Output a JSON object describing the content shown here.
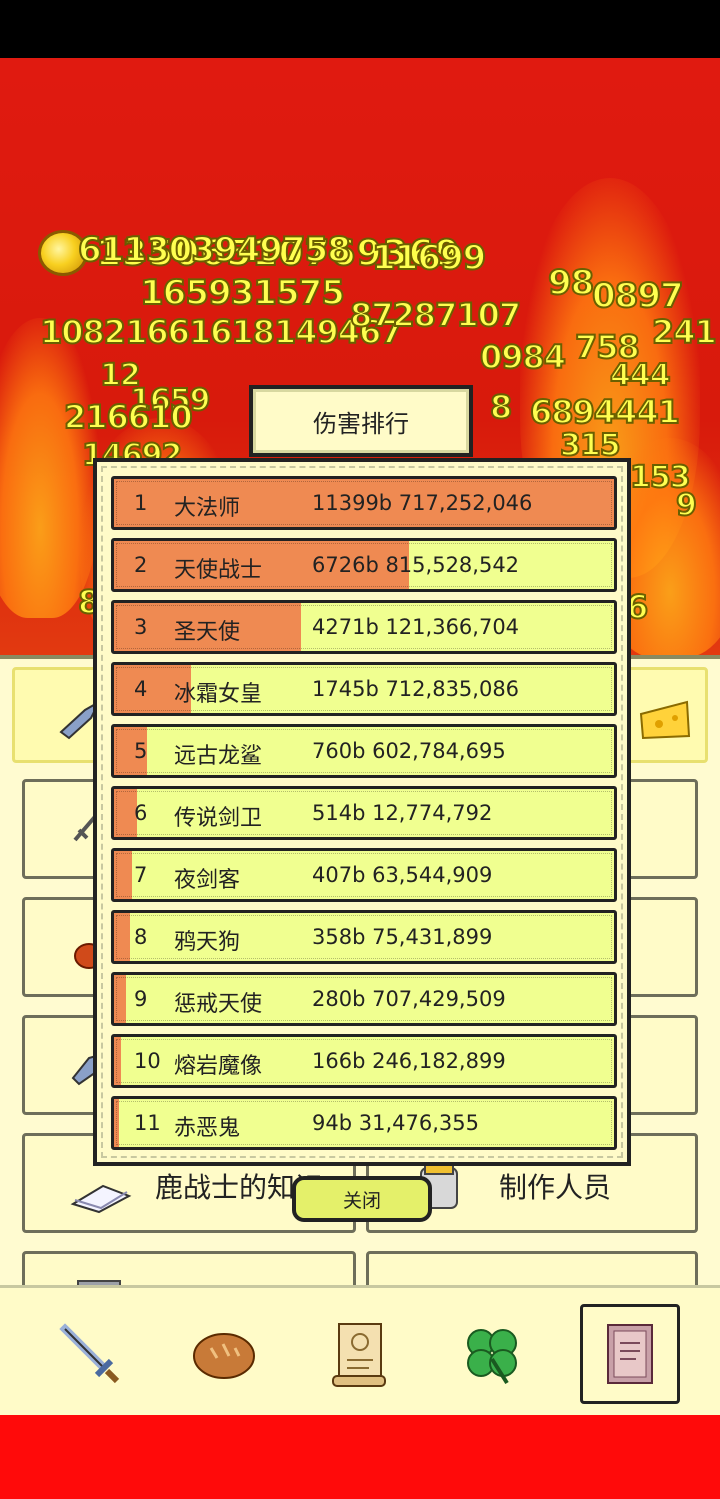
{
  "colors": {
    "background_red": "#e01a10",
    "gold_text": "#ffff4a",
    "row_fill": "#ef8a52",
    "row_bg": "#f0ff90",
    "panel_bg": "#fffbc8"
  },
  "header": {
    "coin_icon": "gold-coin",
    "coin_value": "13506510769369"
  },
  "floating_damage": [
    "611303949758",
    "11699",
    "165931575",
    "98",
    "0897",
    "10821661618149467",
    "0984",
    "758",
    "241",
    "87287107",
    "12",
    "1659",
    "444",
    "216610",
    "8",
    "6894441",
    "14692",
    "315",
    "153",
    "9",
    "8",
    "6"
  ],
  "menu": {
    "cards": [
      {
        "icon": "sword-icon",
        "label": ""
      },
      {
        "icon": "fist-icon",
        "label": ""
      },
      {
        "icon": "shoe-icon",
        "label": ""
      },
      {
        "icon": "book-icon",
        "label": "鹿战士的知识"
      },
      {
        "icon": "mug-icon",
        "label": "制作人员"
      }
    ]
  },
  "modal": {
    "title": "伤害排行",
    "close_label": "关闭",
    "max_damage": 11399,
    "rows": [
      {
        "rank": "1",
        "name": "大法师",
        "value": "11399b 717,252,046",
        "damage": 11399
      },
      {
        "rank": "2",
        "name": "天使战士",
        "value": "6726b 815,528,542",
        "damage": 6726
      },
      {
        "rank": "3",
        "name": "圣天使",
        "value": "4271b 121,366,704",
        "damage": 4271
      },
      {
        "rank": "4",
        "name": "冰霜女皇",
        "value": "1745b 712,835,086",
        "damage": 1745
      },
      {
        "rank": "5",
        "name": "远古龙鲨",
        "value": "760b 602,784,695",
        "damage": 760
      },
      {
        "rank": "6",
        "name": "传说剑卫",
        "value": "514b 12,774,792",
        "damage": 514
      },
      {
        "rank": "7",
        "name": "夜剑客",
        "value": "407b 63,544,909",
        "damage": 407
      },
      {
        "rank": "8",
        "name": "鸦天狗",
        "value": "358b 75,431,899",
        "damage": 358
      },
      {
        "rank": "9",
        "name": "惩戒天使",
        "value": "280b 707,429,509",
        "damage": 280
      },
      {
        "rank": "10",
        "name": "熔岩魔像",
        "value": "166b 246,182,899",
        "damage": 166
      },
      {
        "rank": "11",
        "name": "赤恶鬼",
        "value": "94b 31,476,355",
        "damage": 94
      }
    ]
  },
  "bottom_nav": [
    {
      "icon": "sword-icon",
      "active": false
    },
    {
      "icon": "bread-icon",
      "active": false
    },
    {
      "icon": "scroll-icon",
      "active": false
    },
    {
      "icon": "clover-icon",
      "active": false
    },
    {
      "icon": "book-icon",
      "active": true
    }
  ]
}
